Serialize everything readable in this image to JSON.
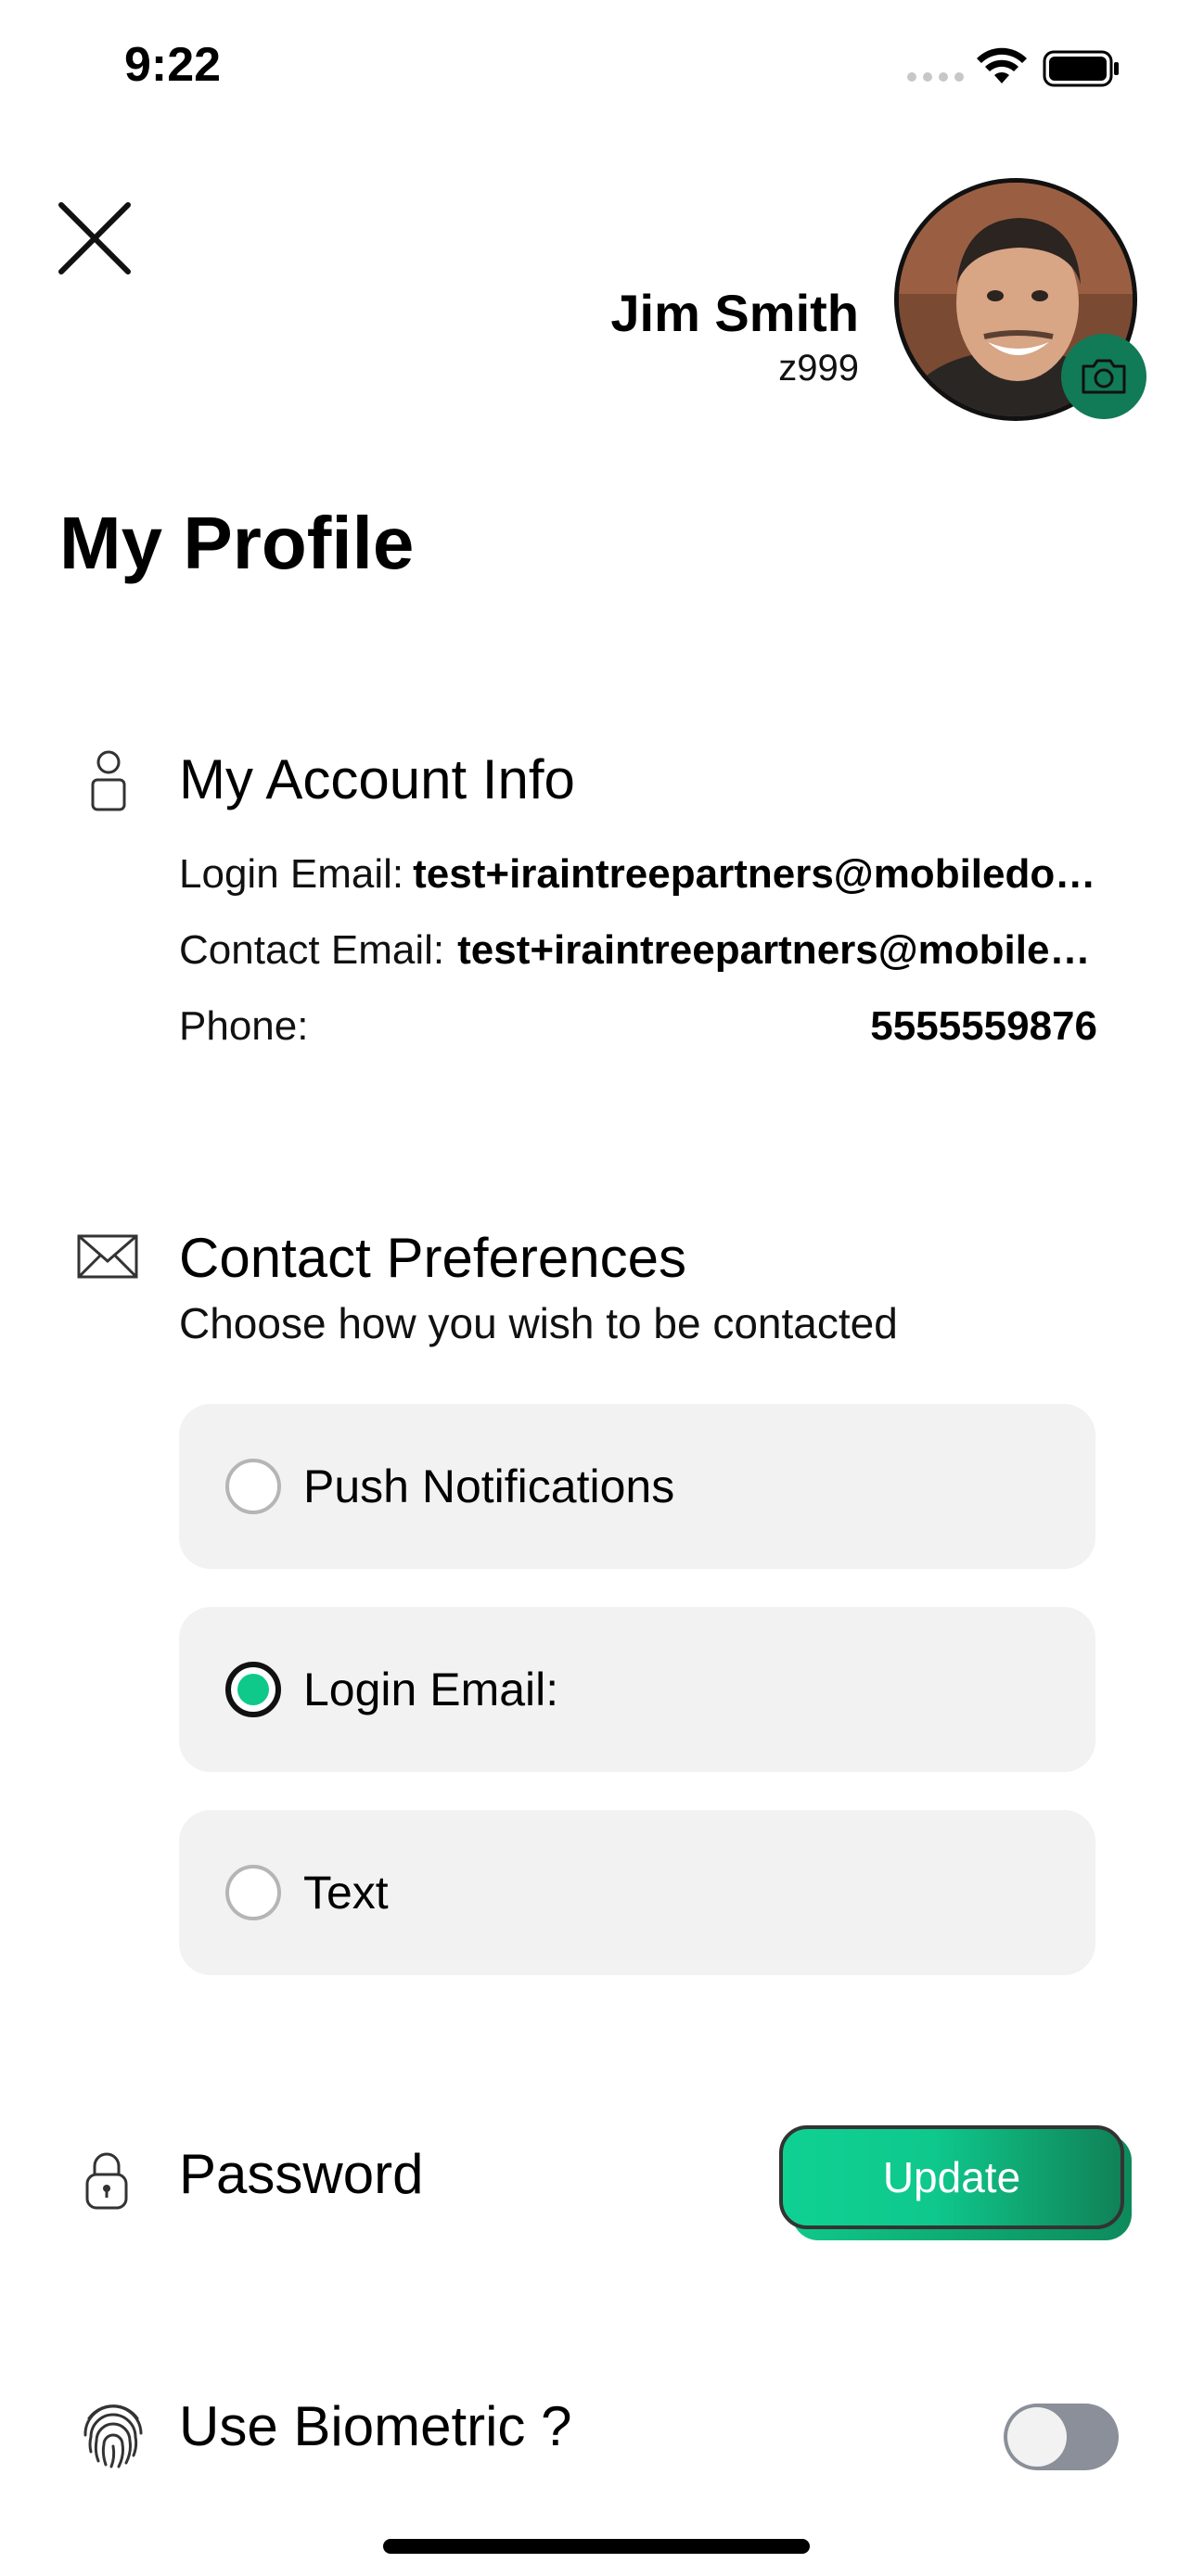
{
  "status_bar": {
    "time": "9:22"
  },
  "header": {
    "user_name": "Jim Smith",
    "user_id": "z999",
    "avatar_badge_icon": "camera-icon",
    "badge_color": "#117a57"
  },
  "page": {
    "title": "My Profile"
  },
  "account_info": {
    "title": "My Account Info",
    "icon": "person-icon",
    "login_email_label": "Login Email:",
    "login_email_value": "test+iraintreepartners@mobiledo…",
    "contact_email_label": "Contact Email:",
    "contact_email_value": "test+iraintreepartners@mobile…",
    "phone_label": "Phone:",
    "phone_value": "5555559876"
  },
  "contact_preferences": {
    "title": "Contact Preferences",
    "icon": "envelope-icon",
    "subtitle": "Choose how you wish to be contacted",
    "options": [
      {
        "label": "Push Notifications",
        "selected": false
      },
      {
        "label": "Login Email:",
        "selected": true
      },
      {
        "label": "Text",
        "selected": false
      }
    ],
    "selected_color": "#0fc98a"
  },
  "password": {
    "label": "Password",
    "icon": "lock-icon",
    "button_label": "Update",
    "button_color": "#0fc98a"
  },
  "biometric": {
    "label": "Use Biometric ?",
    "icon": "fingerprint-icon",
    "enabled": false
  }
}
